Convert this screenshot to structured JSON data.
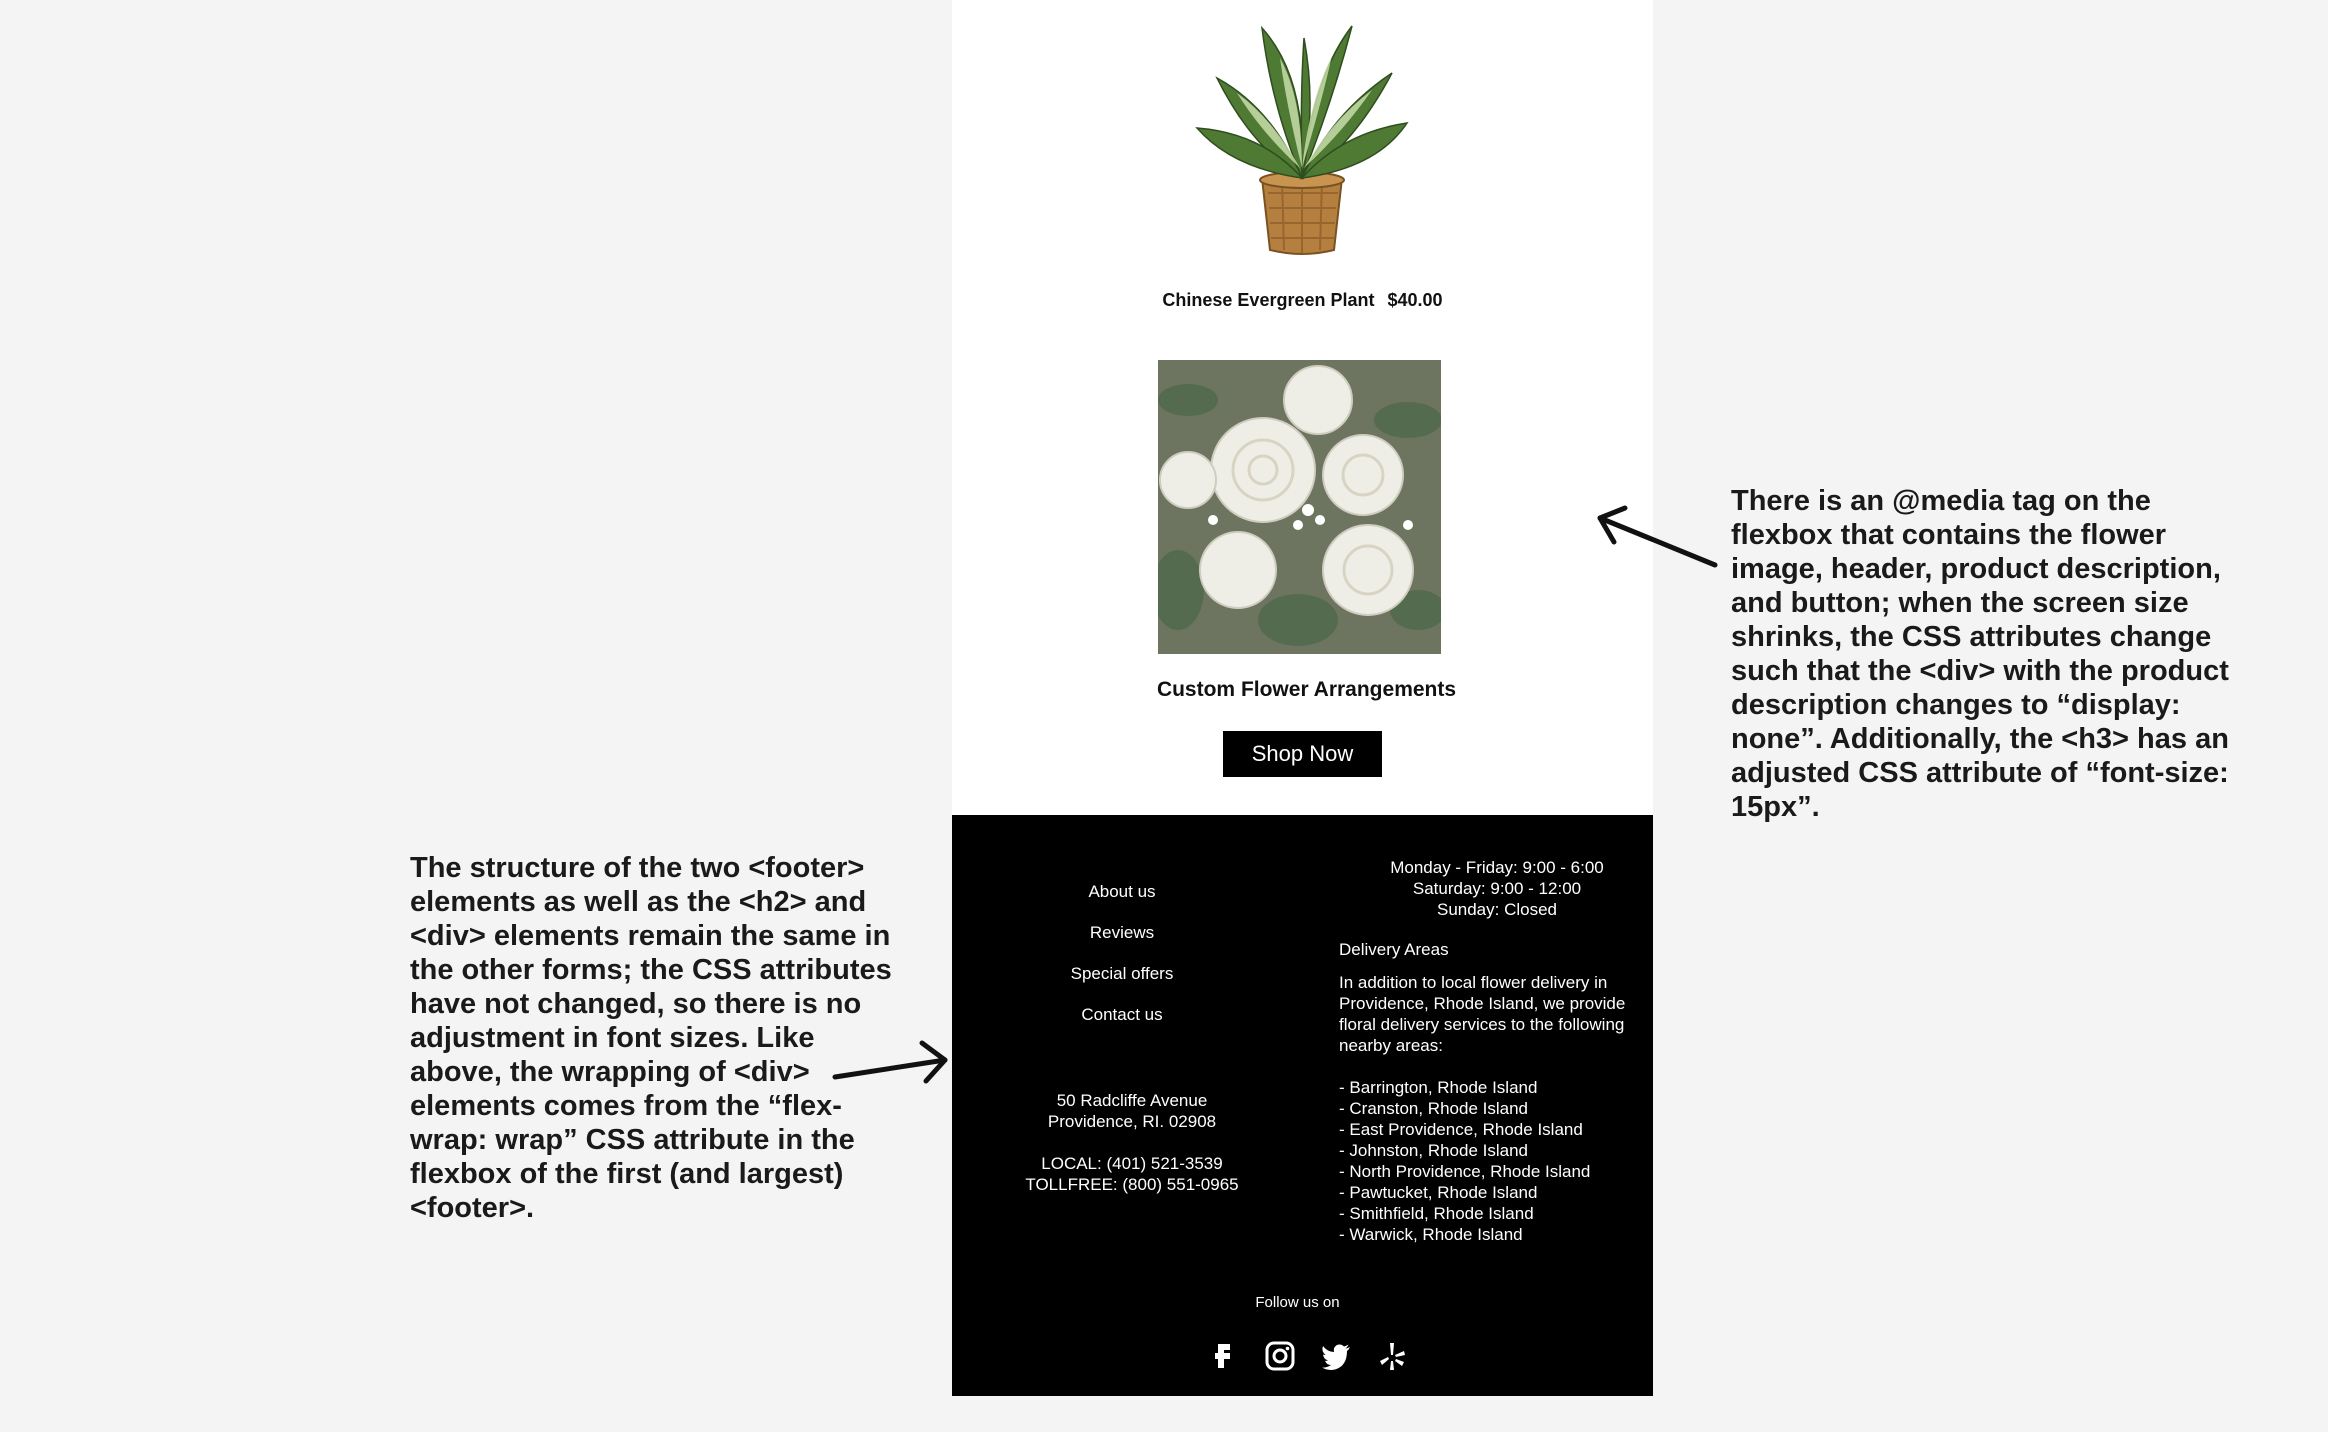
{
  "products": {
    "plant": {
      "name": "Chinese Evergreen Plant",
      "price": "$40.00"
    },
    "flowers": {
      "heading": "Custom Flower Arrangements",
      "button_label": "Shop Now"
    }
  },
  "footer": {
    "links": [
      "About us",
      "Reviews",
      "Special offers",
      "Contact us"
    ],
    "address": {
      "street": "50 Radcliffe Avenue",
      "city": "Providence, RI. 02908",
      "local": "LOCAL: (401) 521-3539",
      "tollfree": "TOLLFREE: (800) 551-0965"
    },
    "hours": [
      "Monday - Friday: 9:00 - 6:00",
      "Saturday: 9:00 - 12:00",
      "Sunday: Closed"
    ],
    "delivery": {
      "title": "Delivery Areas",
      "text": "In addition to local flower delivery in Providence, Rhode Island, we provide floral delivery services to the following nearby areas:",
      "areas": [
        "- Barrington, Rhode Island",
        "- Cranston, Rhode Island",
        "- East Providence, Rhode Island",
        "- Johnston, Rhode Island",
        "- North Providence, Rhode Island",
        "- Pawtucket, Rhode Island",
        "- Smithfield, Rhode Island",
        "- Warwick, Rhode Island"
      ]
    },
    "follow_label": "Follow us on",
    "social_icons": [
      "facebook-icon",
      "instagram-icon",
      "twitter-icon",
      "yelp-icon"
    ]
  },
  "annotations": {
    "right": "There is an @media tag on the flexbox that contains the flower image, header, product description, and button; when the screen size shrinks, the CSS attributes change such that the <div> with the product description changes to “display: none”. Additionally, the <h3> has an adjusted CSS attribute of “font-size: 15px”.",
    "left": "The structure of the two <footer> elements as well as the <h2> and <div> elements remain the same in the other forms; the CSS attributes have not changed, so there is no adjustment in font sizes. Like above, the wrapping of <div> elements comes from the “flex-wrap: wrap” CSS attribute in the flexbox of the first (and largest) <footer>."
  },
  "colors": {
    "background": "#f4f4f4",
    "footer": "#000000",
    "button": "#000000"
  }
}
